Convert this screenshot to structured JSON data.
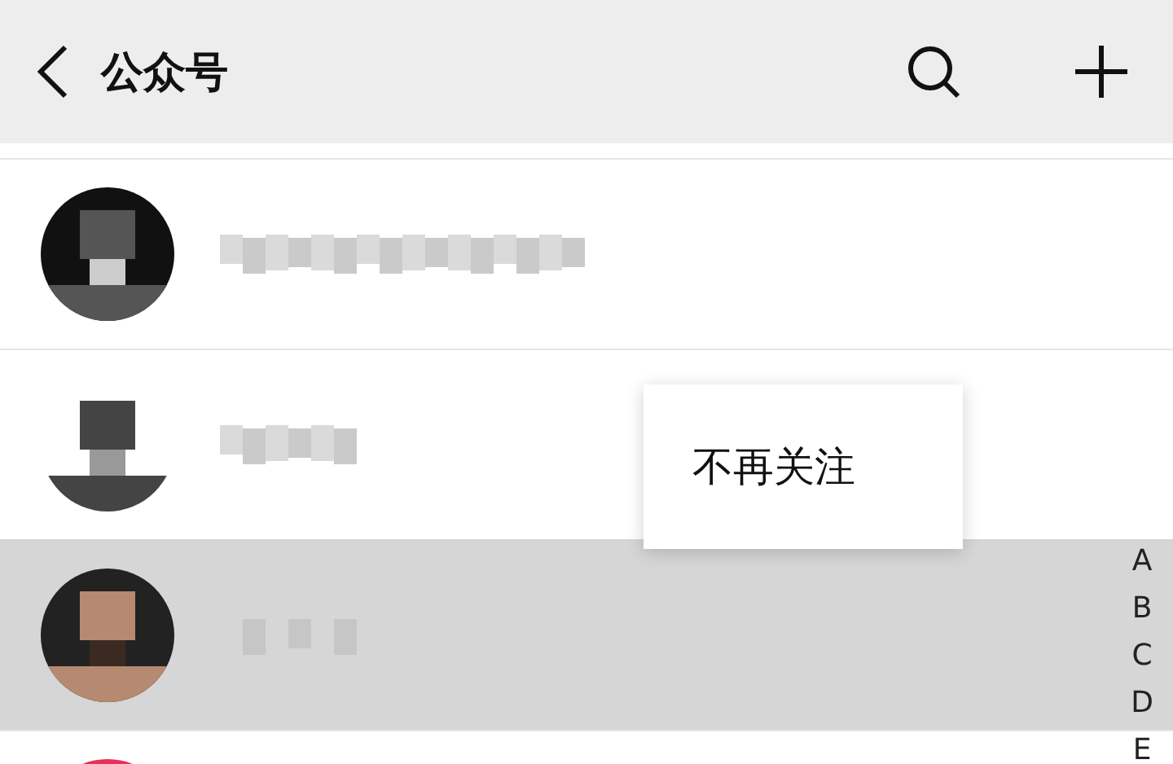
{
  "header": {
    "title": "公众号"
  },
  "accounts": [
    {
      "selected": false
    },
    {
      "selected": false
    },
    {
      "selected": true
    },
    {
      "selected": false
    }
  ],
  "context_menu": {
    "items": [
      "不再关注"
    ]
  },
  "index": [
    "A",
    "B",
    "C",
    "D",
    "E"
  ]
}
